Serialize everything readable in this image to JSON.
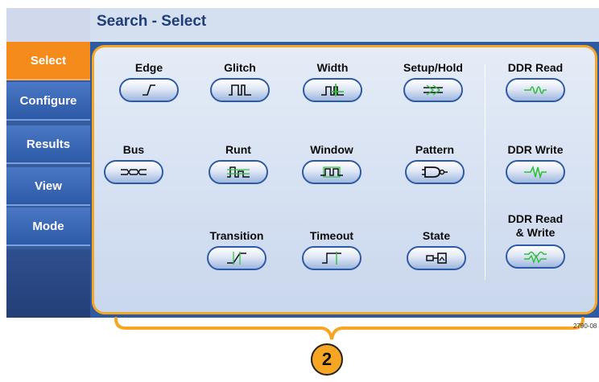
{
  "header": {
    "title": "Search - Select"
  },
  "sidebar": {
    "items": [
      {
        "label": "Select",
        "active": true
      },
      {
        "label": "Configure",
        "active": false
      },
      {
        "label": "Results",
        "active": false
      },
      {
        "label": "View",
        "active": false
      },
      {
        "label": "Mode",
        "active": false
      }
    ]
  },
  "search_types": [
    {
      "label": "Edge",
      "icon": "edge-icon"
    },
    {
      "label": "Glitch",
      "icon": "glitch-icon"
    },
    {
      "label": "Width",
      "icon": "width-icon"
    },
    {
      "label": "Setup/Hold",
      "icon": "setup-hold-icon"
    },
    {
      "label": "DDR Read",
      "icon": "ddr-read-icon"
    },
    {
      "label": "Bus",
      "icon": "bus-icon"
    },
    {
      "label": "Runt",
      "icon": "runt-icon"
    },
    {
      "label": "Window",
      "icon": "window-icon"
    },
    {
      "label": "Pattern",
      "icon": "pattern-icon"
    },
    {
      "label": "DDR Write",
      "icon": "ddr-write-icon"
    },
    {
      "label": "Transition",
      "icon": "transition-icon"
    },
    {
      "label": "Timeout",
      "icon": "timeout-icon"
    },
    {
      "label": "State",
      "icon": "state-icon"
    },
    {
      "label": "DDR Read\n& Write",
      "icon": "ddr-read-write-icon"
    }
  ],
  "footer": {
    "doc_id": "2790-08",
    "callout_number": "2"
  },
  "colors": {
    "accent": "#f48b1a",
    "sidebar_blue": "#2d5aa6",
    "header_bg": "#d4dff0",
    "title_text": "#1f3d78",
    "trace_green": "#2fbf3a"
  }
}
